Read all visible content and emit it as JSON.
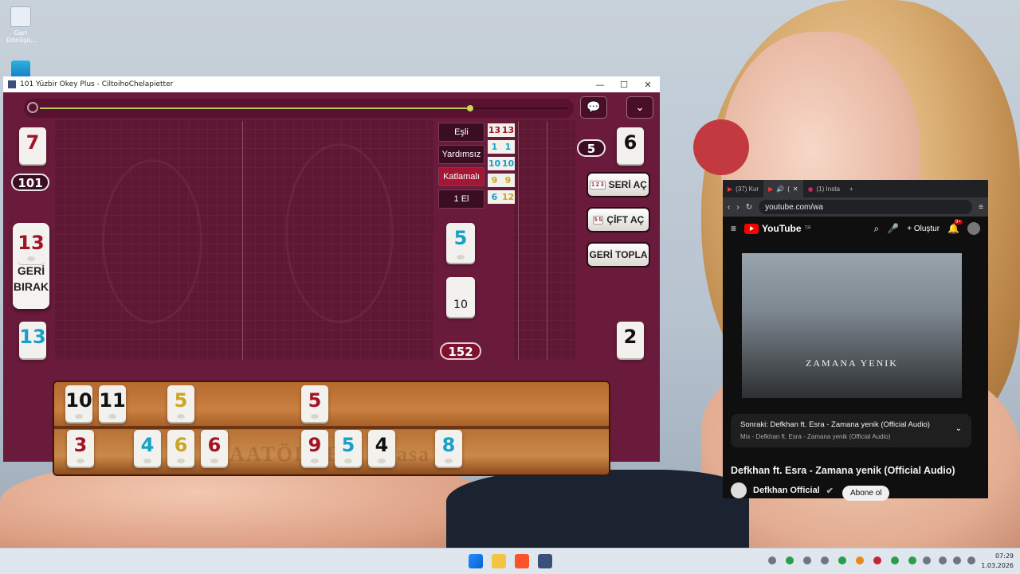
{
  "desktop": {
    "recycle_bin_label": "Geri Dönüşü..."
  },
  "game_window": {
    "title": "101 Yüzbir Okey Plus - CiltoihoChelapietter",
    "left_panel": {
      "top_tile": "7",
      "score": "101",
      "discard_tile": "13",
      "geri_birak_label": "GERİ BIRAK",
      "bottom_tile": "13"
    },
    "modes": [
      "Eşli",
      "Yardımsız",
      "Katlamalı",
      "1 El"
    ],
    "score_table": [
      [
        "13",
        "13"
      ],
      [
        "1",
        "1"
      ],
      [
        "10",
        "10"
      ],
      [
        "9",
        "9"
      ],
      [
        "6",
        "12"
      ]
    ],
    "center": {
      "indicator_tile": "5",
      "deck_count": "10",
      "pot": "152"
    },
    "right_panel": {
      "opponent_count": "5",
      "top_tile": "6",
      "bottom_tile": "2",
      "seri_ac": "SERİ AÇ",
      "cift_ac": "ÇİFT AÇ",
      "geri_topla": "GERİ TOPLA",
      "seri_mini": "1 2 3",
      "cift_mini": "5 5"
    },
    "rack_top": [
      "10",
      "11",
      "5",
      "5"
    ],
    "rack_bottom": [
      "3",
      "4",
      "6",
      "6",
      "9",
      "5",
      "4",
      "8"
    ],
    "colors": {
      "red": "#a11426",
      "blue": "#1aa0c8",
      "black": "#111111",
      "yellow": "#c9a623",
      "table_bg": "#6a1a3b"
    }
  },
  "browser": {
    "tabs": [
      "(37) Kur",
      "(",
      "(1) Insta"
    ],
    "url": "youtube.com/wa",
    "youtube": {
      "logo": "YouTube",
      "country": "TR",
      "create": "Oluştur",
      "notif_badge": "9+",
      "video_caption": "ZAMANA YENIK",
      "next_label": "Sonraki: Defkhan ft. Esra - Zamana yenik (Official Audio)",
      "mix_label": "Mix - Defkhan ft. Esra - Zamana yenik (Official Audio)",
      "video_title": "Defkhan ft. Esra - Zamana yenik (Official Audio)",
      "channel": "Defkhan Official",
      "subscribe": "Abone ol"
    }
  },
  "taskbar": {
    "time": "07:29",
    "date": "1.03.2026"
  }
}
